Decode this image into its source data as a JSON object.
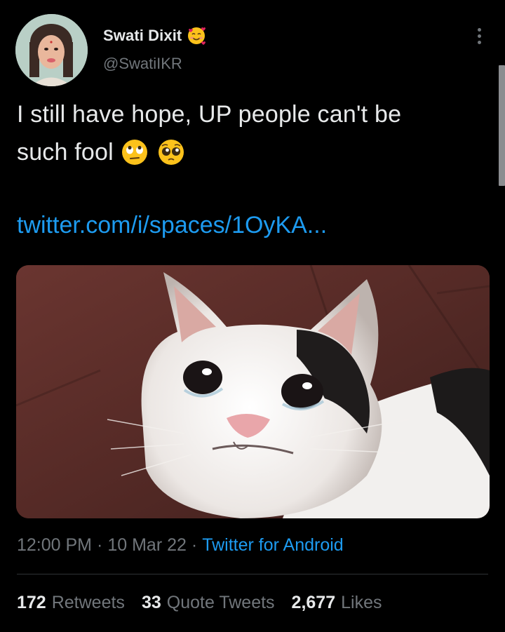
{
  "author": {
    "name": "Swati Dixit",
    "handle": "@SwatiIKR",
    "name_emoji": "smiling-face-with-hearts-icon"
  },
  "tweet": {
    "text_line1": "I still have hope, UP people can't be",
    "text_line2": "such fool",
    "text_emojis": [
      "face-with-rolling-eyes-icon",
      "pleading-face-icon"
    ],
    "link": "twitter.com/i/spaces/1OyKA..."
  },
  "media": {
    "description_icon": "crying-cat-image"
  },
  "meta": {
    "time": "12:00 PM",
    "date": "10 Mar 22",
    "separator": "·",
    "source": "Twitter for Android"
  },
  "stats": {
    "retweets_count": "172",
    "retweets_label": "Retweets",
    "quotes_count": "33",
    "quotes_label": "Quote Tweets",
    "likes_count": "2,677",
    "likes_label": "Likes"
  },
  "colors": {
    "background": "#000000",
    "text": "#e7e9ea",
    "secondary": "#71767b",
    "link": "#1d9bf0",
    "divider": "#2f3336"
  }
}
